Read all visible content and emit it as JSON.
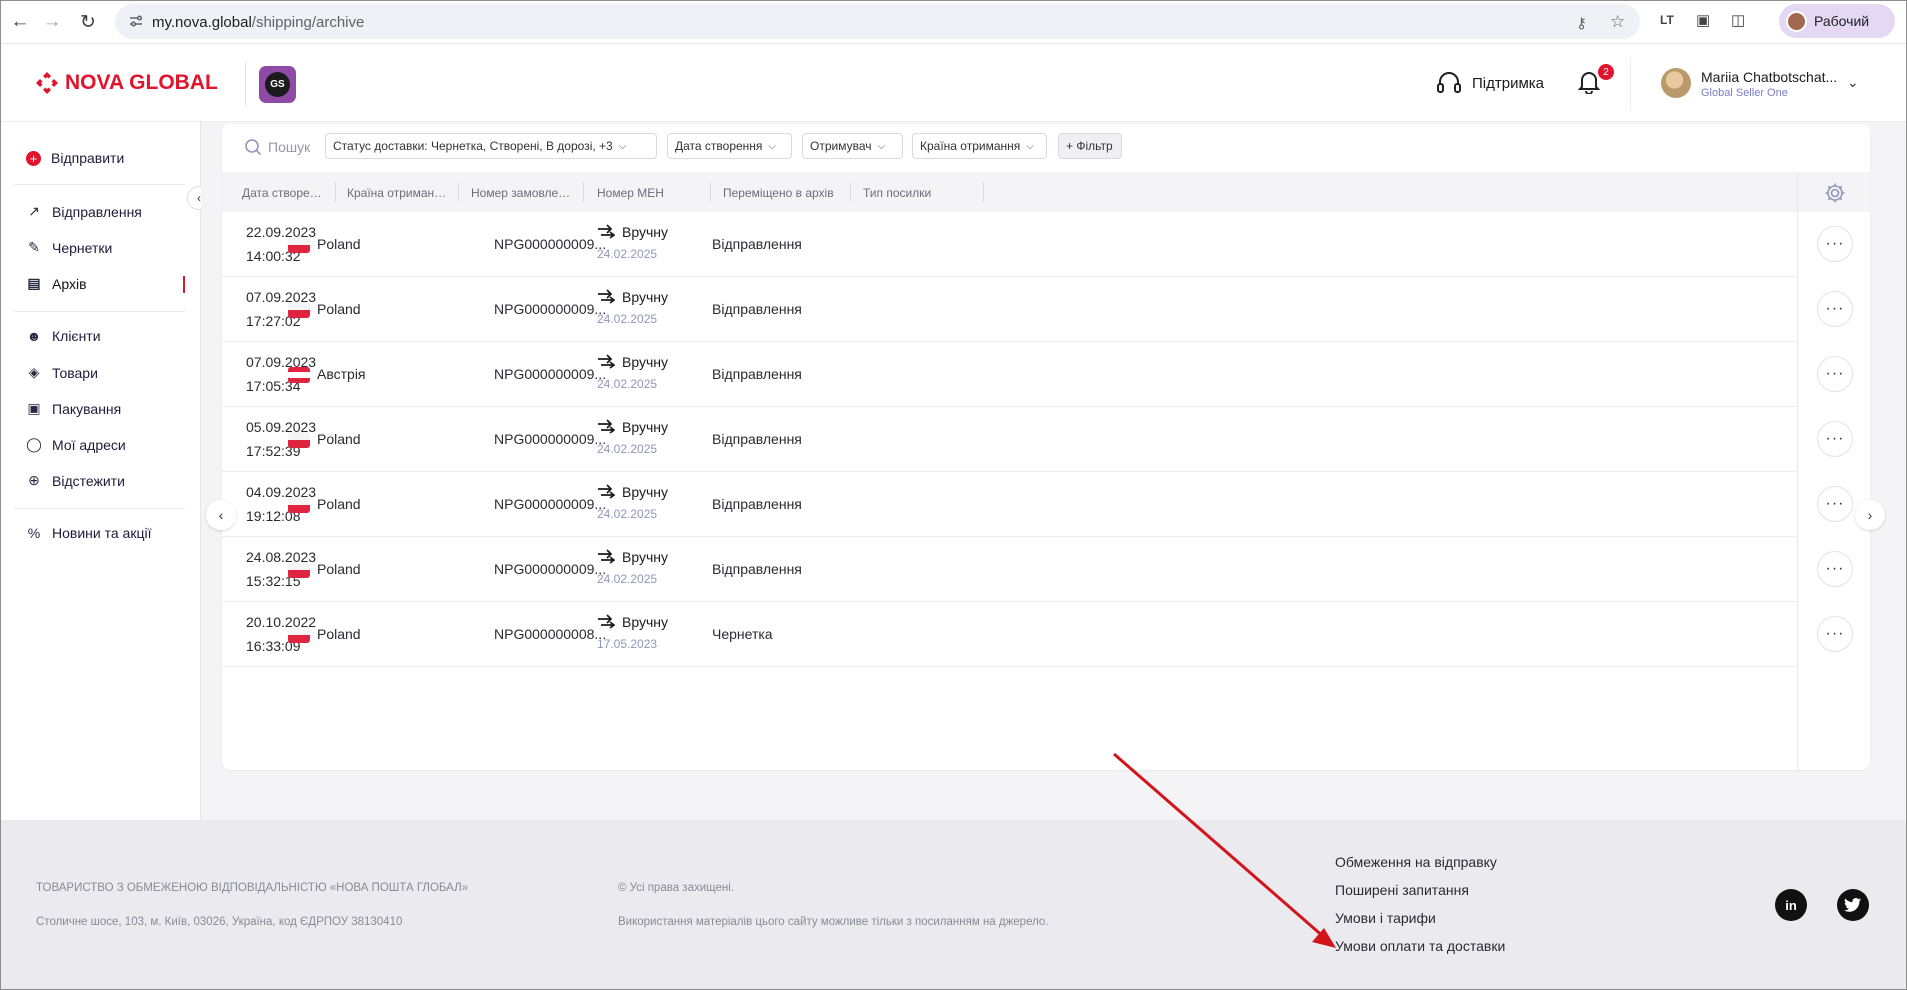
{
  "browser": {
    "url_host": "my.nova.global",
    "url_path": "/shipping/archive",
    "profile_label": "Рабочий"
  },
  "header": {
    "brand": "NOVA GLOBAL",
    "app_badge": "GS",
    "support_label": "Підтримка",
    "notifications_count": "2",
    "user_name": "Mariia Chatbotschat...",
    "user_org": "Global Seller One"
  },
  "sidebar": {
    "send_label": "Відправити",
    "items": [
      {
        "label": "Відправлення",
        "icon": "arrow-up-right-icon"
      },
      {
        "label": "Чернетки",
        "icon": "edit-icon"
      },
      {
        "label": "Архів",
        "icon": "archive-icon"
      },
      {
        "label": "Клієнти",
        "icon": "users-icon"
      },
      {
        "label": "Товари",
        "icon": "tag-icon"
      },
      {
        "label": "Пакування",
        "icon": "package-icon"
      },
      {
        "label": "Мої адреси",
        "icon": "location-icon"
      },
      {
        "label": "Відстежити",
        "icon": "target-icon"
      },
      {
        "label": "Новини та акції",
        "icon": "percent-icon"
      }
    ]
  },
  "filters": {
    "search_placeholder": "Пошук",
    "status": "Статус доставки: Чернетка, Створені, В дорозі, +3",
    "created": "Дата створення",
    "receiver": "Отримувач",
    "country": "Країна отримання",
    "add_filter": "+ Фільтр"
  },
  "table": {
    "columns": [
      "Дата створення",
      "Країна отримання",
      "Номер замовлення",
      "Номер МЕН",
      "Переміщено в архів",
      "Тип посилки"
    ],
    "rows": [
      {
        "date": "22.09.2023",
        "time": "14:00:32",
        "country": "Poland",
        "flag": "pl",
        "men": "NPG000000009...",
        "moved": "Вручну",
        "moved_date": "24.02.2025",
        "type": "Відправлення"
      },
      {
        "date": "07.09.2023",
        "time": "17:27:02",
        "country": "Poland",
        "flag": "pl",
        "men": "NPG000000009...",
        "moved": "Вручну",
        "moved_date": "24.02.2025",
        "type": "Відправлення"
      },
      {
        "date": "07.09.2023",
        "time": "17:05:34",
        "country": "Австрія",
        "flag": "at",
        "men": "NPG000000009...",
        "moved": "Вручну",
        "moved_date": "24.02.2025",
        "type": "Відправлення"
      },
      {
        "date": "05.09.2023",
        "time": "17:52:39",
        "country": "Poland",
        "flag": "pl",
        "men": "NPG000000009...",
        "moved": "Вручну",
        "moved_date": "24.02.2025",
        "type": "Відправлення"
      },
      {
        "date": "04.09.2023",
        "time": "19:12:08",
        "country": "Poland",
        "flag": "pl",
        "men": "NPG000000009...",
        "moved": "Вручну",
        "moved_date": "24.02.2025",
        "type": "Відправлення"
      },
      {
        "date": "24.08.2023",
        "time": "15:32:15",
        "country": "Poland",
        "flag": "pl",
        "men": "NPG000000009...",
        "moved": "Вручну",
        "moved_date": "24.02.2025",
        "type": "Відправлення"
      },
      {
        "date": "20.10.2022",
        "time": "16:33:09",
        "country": "Poland",
        "flag": "pl",
        "men": "NPG000000008...",
        "moved": "Вручну",
        "moved_date": "17.05.2023",
        "type": "Чернетка"
      }
    ]
  },
  "footer": {
    "company": "ТОВАРИСТВО З ОБМЕЖЕНОЮ ВІДПОВІДАЛЬНІСТЮ «НОВА ПОШТА ГЛОБАЛ»",
    "address": "Столичне шосе, 103, м. Київ, 03026, Україна, код ЄДРПОУ 38130410",
    "rights": "© Усі права захищені.",
    "usage": "Використання матеріалів цього сайту можливе тільки з посиланням на джерело.",
    "links": [
      "Обмеження на відправку",
      "Поширені запитання",
      "Умови і тарифи",
      "Умови оплати та доставки"
    ]
  },
  "colors": {
    "brand_red": "#e0152d",
    "annotation_arrow": "#d4141c"
  }
}
